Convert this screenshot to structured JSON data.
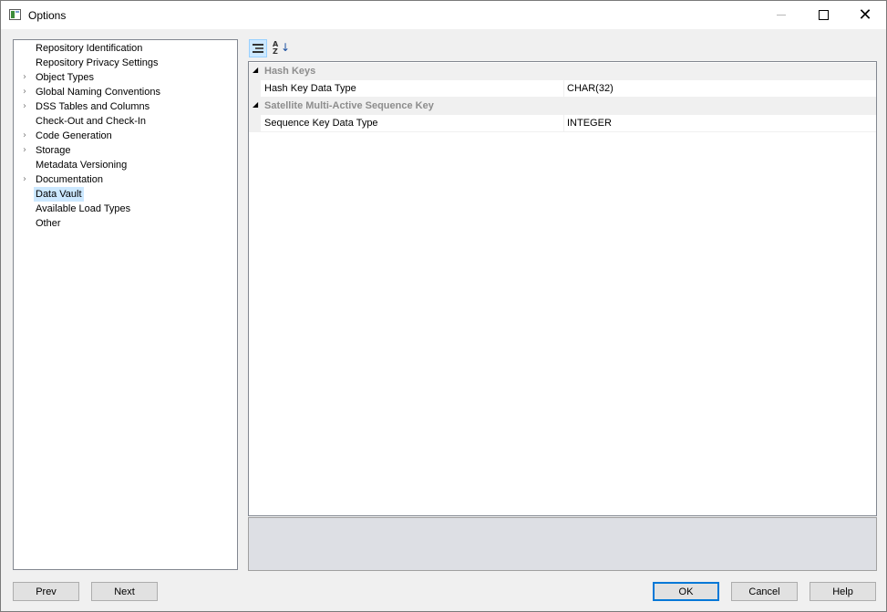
{
  "window": {
    "title": "Options"
  },
  "tree": {
    "items": [
      {
        "label": "Repository Identification",
        "expandable": false
      },
      {
        "label": "Repository Privacy Settings",
        "expandable": false
      },
      {
        "label": "Object Types",
        "expandable": true
      },
      {
        "label": "Global Naming Conventions",
        "expandable": true
      },
      {
        "label": "DSS Tables and Columns",
        "expandable": true
      },
      {
        "label": "Check-Out and Check-In",
        "expandable": false
      },
      {
        "label": "Code Generation",
        "expandable": true
      },
      {
        "label": "Storage",
        "expandable": true
      },
      {
        "label": "Metadata Versioning",
        "expandable": false
      },
      {
        "label": "Documentation",
        "expandable": true
      },
      {
        "label": "Data Vault",
        "expandable": false,
        "selected": true
      },
      {
        "label": "Available Load Types",
        "expandable": false
      },
      {
        "label": "Other",
        "expandable": false
      }
    ],
    "expand_glyph": "chevron-right-icon"
  },
  "property_grid": {
    "categories": [
      {
        "label": "Hash Keys",
        "properties": [
          {
            "name": "Hash Key Data Type",
            "value": "CHAR(32)"
          }
        ]
      },
      {
        "label": "Satellite Multi-Active Sequence Key",
        "properties": [
          {
            "name": "Sequence Key Data Type",
            "value": "INTEGER"
          }
        ]
      }
    ]
  },
  "buttons": {
    "prev": "Prev",
    "next": "Next",
    "ok": "OK",
    "cancel": "Cancel",
    "help": "Help"
  },
  "colors": {
    "selection": "#cce8ff",
    "category_text": "#8d8d8d",
    "default_button_border": "#0078d7",
    "description_panel": "#dddfe4"
  }
}
